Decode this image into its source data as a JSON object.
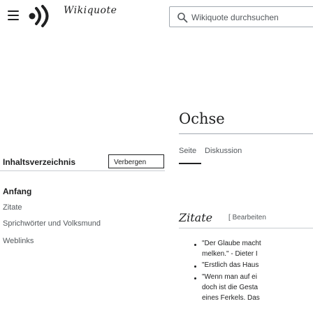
{
  "header": {
    "menu_icon": "hamburger-menu-icon",
    "logo_icon": "wikiquote-logo-icon",
    "logo_text": "Wikiquote",
    "search": {
      "placeholder": "Wikiquote durchsuchen",
      "icon": "search-icon"
    }
  },
  "toc": {
    "title": "Inhaltsverzeichnis",
    "hide_label": "Verbergen",
    "items": [
      {
        "label": "Anfang",
        "active": true
      },
      {
        "label": "Zitate",
        "active": false
      },
      {
        "label": "Sprichwörter und Volksmund",
        "active": false
      },
      {
        "label": "Weblinks",
        "active": false
      }
    ]
  },
  "article": {
    "title": "Ochse",
    "tabs": [
      {
        "label": "Seite",
        "selected": true
      },
      {
        "label": "Diskussion",
        "selected": false
      }
    ],
    "section": {
      "heading": "Zitate",
      "edit_prefix": "[ ",
      "edit_label": "Bearbeiten",
      "quotes": [
        {
          "lines": [
            "\"Der Glaube macht",
            "melken.\" - Dieter I"
          ]
        },
        {
          "lines": [
            "\"Erstlich das Haus"
          ]
        },
        {
          "lines": [
            "\"Wenn man auf ei",
            "doch ist die Gesta",
            "eines Ferkels. Das"
          ]
        }
      ]
    }
  },
  "colors": {
    "text": "#202122",
    "secondary_text": "#54595d",
    "border": "#a2a9b1",
    "background": "#ffffff"
  }
}
